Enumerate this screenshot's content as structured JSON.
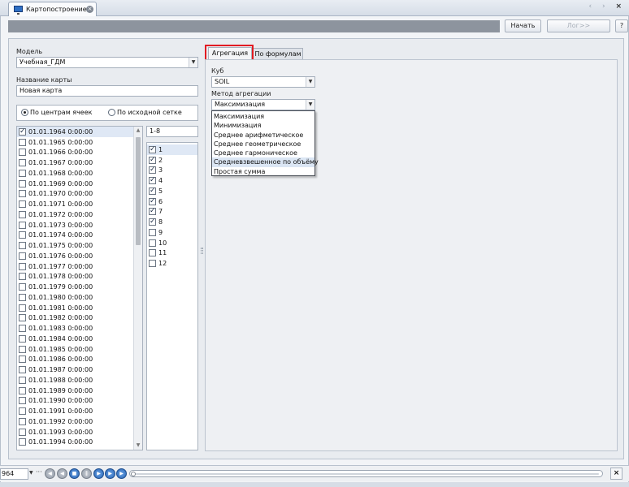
{
  "tab": {
    "title": "Картопостроение"
  },
  "toolbar": {
    "start_label": "Начать",
    "log_label": "Лог>>",
    "help_label": "?"
  },
  "model": {
    "label": "Модель",
    "value": "Учебная_ГДМ"
  },
  "map_name": {
    "label": "Название карты",
    "value": "Новая карта"
  },
  "mode": {
    "option_centers": "По центрам ячеек",
    "option_source": "По исходной сетке",
    "selected": "option_centers"
  },
  "dates": [
    {
      "label": "01.01.1964 0:00:00",
      "checked": true
    },
    {
      "label": "01.01.1965 0:00:00",
      "checked": false
    },
    {
      "label": "01.01.1966 0:00:00",
      "checked": false
    },
    {
      "label": "01.01.1967 0:00:00",
      "checked": false
    },
    {
      "label": "01.01.1968 0:00:00",
      "checked": false
    },
    {
      "label": "01.01.1969 0:00:00",
      "checked": false
    },
    {
      "label": "01.01.1970 0:00:00",
      "checked": false
    },
    {
      "label": "01.01.1971 0:00:00",
      "checked": false
    },
    {
      "label": "01.01.1972 0:00:00",
      "checked": false
    },
    {
      "label": "01.01.1973 0:00:00",
      "checked": false
    },
    {
      "label": "01.01.1974 0:00:00",
      "checked": false
    },
    {
      "label": "01.01.1975 0:00:00",
      "checked": false
    },
    {
      "label": "01.01.1976 0:00:00",
      "checked": false
    },
    {
      "label": "01.01.1977 0:00:00",
      "checked": false
    },
    {
      "label": "01.01.1978 0:00:00",
      "checked": false
    },
    {
      "label": "01.01.1979 0:00:00",
      "checked": false
    },
    {
      "label": "01.01.1980 0:00:00",
      "checked": false
    },
    {
      "label": "01.01.1981 0:00:00",
      "checked": false
    },
    {
      "label": "01.01.1982 0:00:00",
      "checked": false
    },
    {
      "label": "01.01.1983 0:00:00",
      "checked": false
    },
    {
      "label": "01.01.1984 0:00:00",
      "checked": false
    },
    {
      "label": "01.01.1985 0:00:00",
      "checked": false
    },
    {
      "label": "01.01.1986 0:00:00",
      "checked": false
    },
    {
      "label": "01.01.1987 0:00:00",
      "checked": false
    },
    {
      "label": "01.01.1988 0:00:00",
      "checked": false
    },
    {
      "label": "01.01.1989 0:00:00",
      "checked": false
    },
    {
      "label": "01.01.1990 0:00:00",
      "checked": false
    },
    {
      "label": "01.01.1991 0:00:00",
      "checked": false
    },
    {
      "label": "01.01.1992 0:00:00",
      "checked": false
    },
    {
      "label": "01.01.1993 0:00:00",
      "checked": false
    },
    {
      "label": "01.01.1994 0:00:00",
      "checked": false
    }
  ],
  "layers": {
    "range": "1-8",
    "items": [
      {
        "label": "1",
        "checked": true
      },
      {
        "label": "2",
        "checked": true
      },
      {
        "label": "3",
        "checked": true
      },
      {
        "label": "4",
        "checked": true
      },
      {
        "label": "5",
        "checked": true
      },
      {
        "label": "6",
        "checked": true
      },
      {
        "label": "7",
        "checked": true
      },
      {
        "label": "8",
        "checked": true
      },
      {
        "label": "9",
        "checked": false
      },
      {
        "label": "10",
        "checked": false
      },
      {
        "label": "11",
        "checked": false
      },
      {
        "label": "12",
        "checked": false
      }
    ]
  },
  "tabs": {
    "aggregation": "Агрегация",
    "formulas": "По формулам"
  },
  "cube": {
    "label": "Куб",
    "value": "SOIL"
  },
  "method": {
    "label": "Метод агрегации",
    "value": "Максимизация",
    "options": [
      "Максимизация",
      "Минимизация",
      "Среднее арифметическое",
      "Среднее геометрическое",
      "Среднее гармоническое",
      "Средневзвешенное по объёму",
      "Простая сумма"
    ],
    "hovered_index": 5
  },
  "playback": {
    "date_value": "964",
    "close_label": "×"
  },
  "window": {
    "controls": "‹ › ×"
  }
}
